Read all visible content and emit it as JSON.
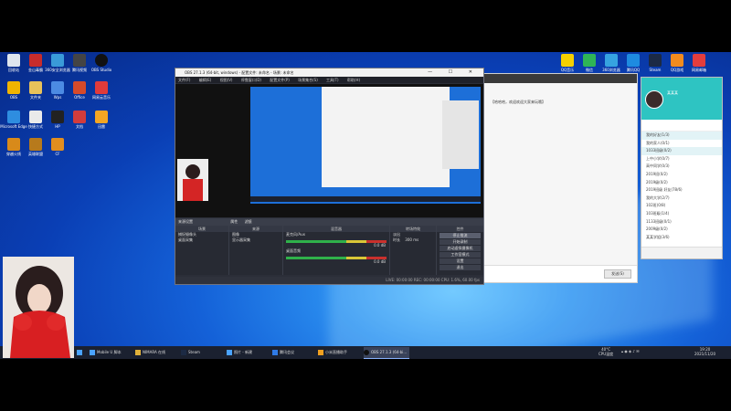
{
  "obs": {
    "title": "OBS 27.1.3 (64-bit, windows) - 配置文件: 未命名 - 场景: 未命名",
    "window_controls": "— ☐ ✕",
    "menu": [
      "文件(F)",
      "编辑(E)",
      "视图(V)",
      "停靠窗口(D)",
      "配置文件(P)",
      "场景集合(S)",
      "工具(T)",
      "帮助(H)"
    ],
    "panel_bar": [
      "来源设置",
      "属性",
      "滤镜"
    ],
    "scenes": {
      "header": "场景",
      "items": [
        "捕捉摄像头",
        "桌面采集"
      ]
    },
    "sources": {
      "header": "来源",
      "items": [
        "图像",
        "显示器采集"
      ]
    },
    "mixer": {
      "header": "混音器",
      "channels": [
        {
          "name": "麦克风/Aux",
          "level": "0.0 dB"
        },
        {
          "name": "桌面音频",
          "level": "0.0 dB"
        }
      ]
    },
    "transitions": {
      "header": "转场特效",
      "type_label": "淡出",
      "duration_label": "时长",
      "duration": "300 ms"
    },
    "controls": {
      "header": "控件",
      "buttons": [
        "停止推流",
        "开始录制",
        "启动虚拟摄像机",
        "工作室模式",
        "设置",
        "退出"
      ]
    },
    "status": "LIVE: 00:00:00   REC: 00:00:00   CPU: 1.6%, 60.00 fps"
  },
  "chat": {
    "message": "【哈哈哈，欢迎欢迎大家来玩哦】",
    "send_label": "发送(S)"
  },
  "qq": {
    "nickname": "某某某",
    "groups": [
      "我的好友(1/3)",
      "我的家人(0/1)",
      "1033班级(0/2)",
      "上中小学(0/7)",
      "高中同学(0/3)",
      "2019班(0/2)",
      "2019级(0/2)",
      "2019班级 好友(78/6)",
      "我的大学(2/7)",
      "102班(0/8)",
      "103班级(1/4)",
      "1133班级(0/1)",
      "2009级(0/2)",
      "某某学姐(3/6)"
    ]
  },
  "desktop_icons": [
    "回收站",
    "金山毒霸",
    "360安全浏览器",
    "腾讯视频",
    "OBS Studio",
    "OBS",
    "文件夹",
    "Wps",
    "Office",
    "网易云音乐",
    "Microsoft Edge",
    "快捷方式",
    "HP",
    "文档",
    "迅雷",
    "穿越火线",
    "英雄联盟",
    "CF"
  ],
  "top_icons": [
    "QQ音乐",
    "微信",
    "360浏览器",
    "腾讯QQ",
    "Steam",
    "QQ游戏",
    "网易邮箱"
  ],
  "taskbar": {
    "items": [
      "Mobile U 脚本",
      "NIMARA 在线",
      "Steam",
      "照片 - 新建",
      "腾讯会议",
      "小米直播助手",
      "OBS 27.1.3 (64-bi..."
    ],
    "tray_temp": "40°C",
    "tray_cpu": "CPU温度",
    "time": "19:20",
    "date": "2021/11/20"
  }
}
